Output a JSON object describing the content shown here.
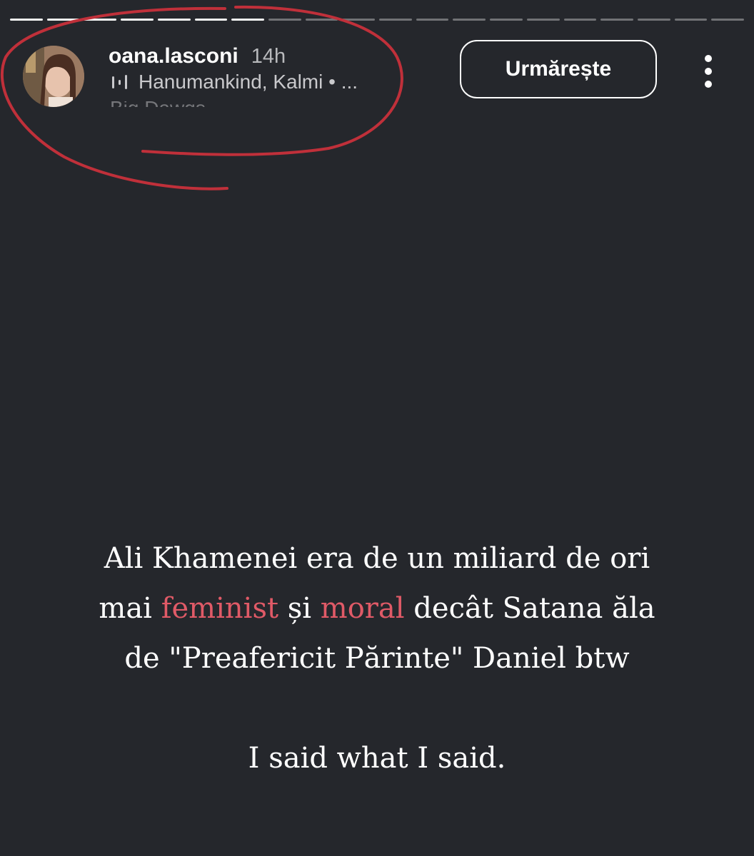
{
  "story": {
    "progress_segments_total": 20,
    "progress_segments_seen": 7,
    "user": {
      "username": "oana.lasconi",
      "time_ago": "14h"
    },
    "music": {
      "icon": "music-bars-icon",
      "label": "Hanumankind, Kalmi • ...",
      "sub_label_truncated": "Big Dawgs"
    },
    "follow_label": "Urmărește",
    "more_icon": "vertical-ellipsis-icon",
    "annotation_color": "#c0303a",
    "text": {
      "line1": "Ali Khamenei era de un miliard de ori",
      "line2_pre": "mai ",
      "line2_hl1": "feminist",
      "line2_mid1": " și ",
      "line2_hl2": "moral",
      "line2_post": " decât Satana ăla",
      "line3": "de \"Preafericit Părinte\" Daniel btw",
      "closing": "I said what I said."
    },
    "highlight_color": "#e05a67",
    "background_color": "#25272c"
  }
}
